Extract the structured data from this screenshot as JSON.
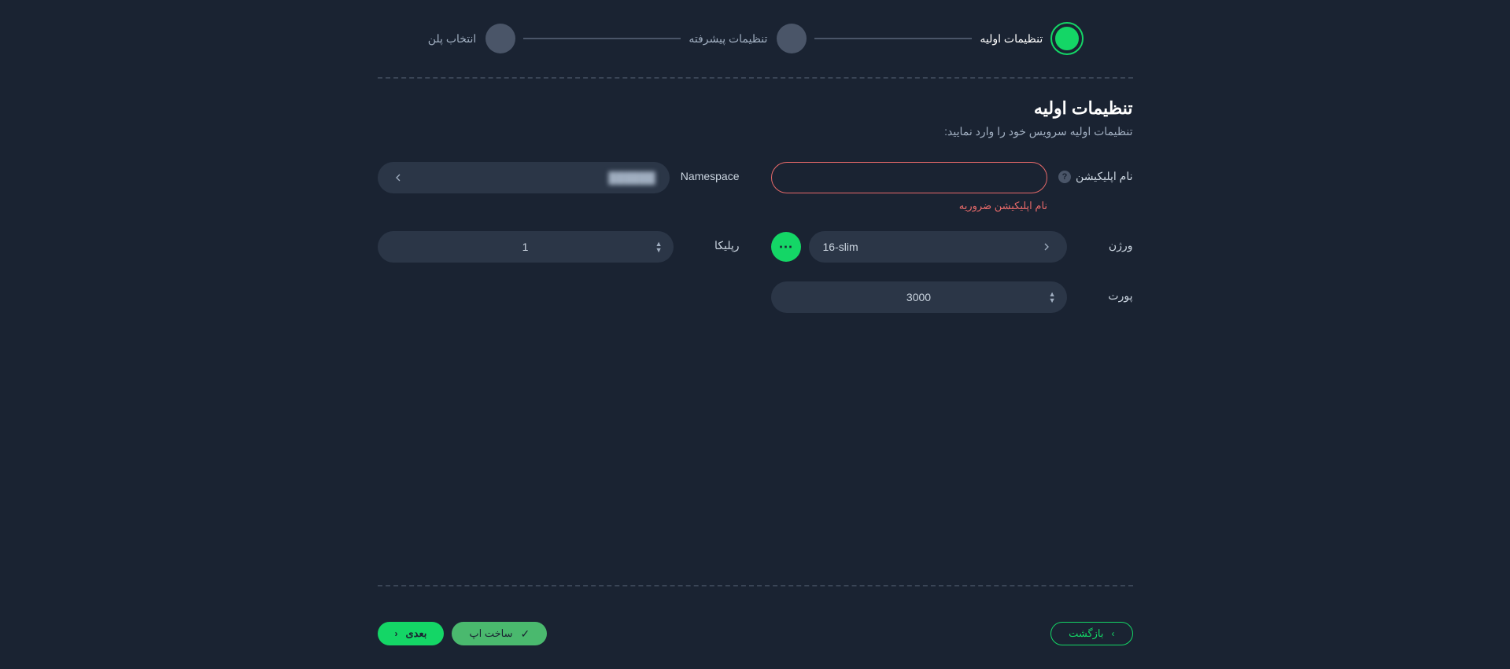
{
  "stepper": {
    "step1": "تنظیمات اولیه",
    "step2": "تنظیمات پیشرفته",
    "step3": "انتخاب پلن"
  },
  "heading": {
    "title": "تنظیمات اولیه",
    "subtitle": "تنظیمات اولیه سرویس خود را وارد نمایید:"
  },
  "labels": {
    "appName": "نام اپلیکیشن",
    "namespace": "Namespace",
    "version": "ورژن",
    "replica": "رپلیکا",
    "port": "پورت"
  },
  "values": {
    "appName": "",
    "namespace": "██████",
    "version": "16-slim",
    "replica": "1",
    "port": "3000"
  },
  "errors": {
    "appName": "نام اپلیکیشن ضروریه"
  },
  "buttons": {
    "back": "بازگشت",
    "build": "ساخت اپ",
    "next": "بعدی"
  },
  "icons": {
    "more": "⋯",
    "help": "?",
    "check": "✓"
  }
}
